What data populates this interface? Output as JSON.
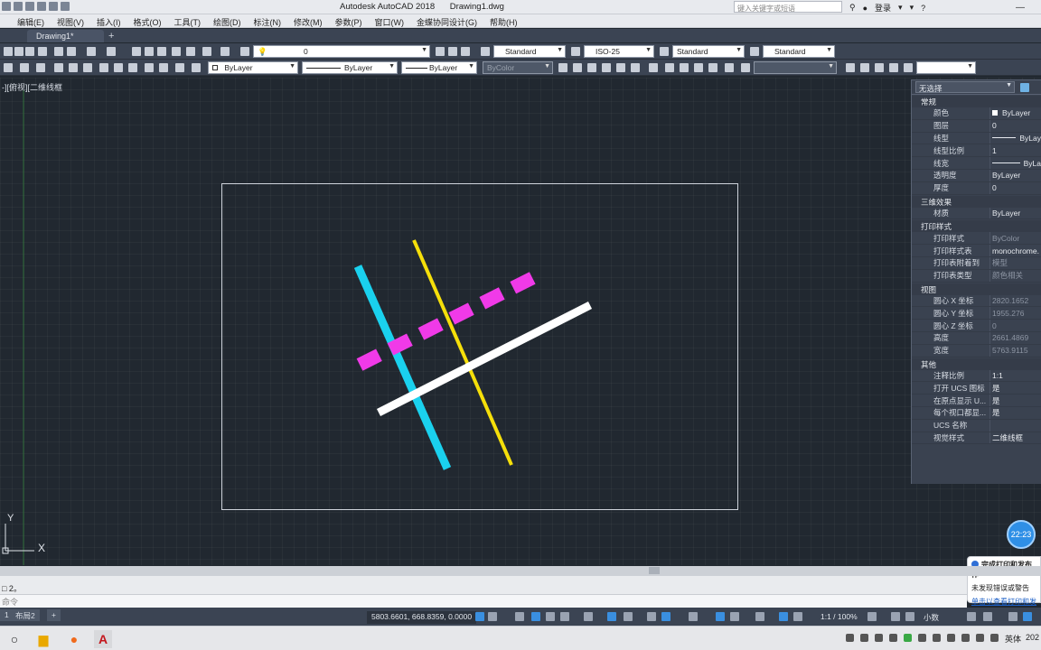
{
  "app": {
    "title": "Autodesk AutoCAD 2018",
    "document": "Drawing1.dwg",
    "search_placeholder": "键入关键字或短语",
    "signin": "登录"
  },
  "menu": [
    "编辑(E)",
    "视图(V)",
    "插入(I)",
    "格式(O)",
    "工具(T)",
    "绘图(D)",
    "标注(N)",
    "修改(M)",
    "参数(P)",
    "窗口(W)",
    "金蝶协同设计(G)",
    "帮助(H)"
  ],
  "file_tab": "Drawing1*",
  "toolbar": {
    "layer_value": "0",
    "text_style": "Standard",
    "dim_style": "ISO-25",
    "table_style": "Standard",
    "multileader_style": "Standard",
    "color": "ByLayer",
    "linetype": "ByLayer",
    "lineweight": "ByLayer",
    "plotstyle": "ByColor"
  },
  "viewport_label": "-][俯视][二维线框",
  "ucs": {
    "x": "X",
    "y": "Y"
  },
  "palette": {
    "selection": "无选择",
    "sections": [
      {
        "title": "常规",
        "rows": [
          {
            "k": "颜色",
            "v": "ByLayer",
            "kind": "swatch"
          },
          {
            "k": "图层",
            "v": "0"
          },
          {
            "k": "线型",
            "v": "ByLay",
            "kind": "line"
          },
          {
            "k": "线型比例",
            "v": "1"
          },
          {
            "k": "线宽",
            "v": "ByLa",
            "kind": "line"
          },
          {
            "k": "透明度",
            "v": "ByLayer"
          },
          {
            "k": "厚度",
            "v": "0"
          }
        ]
      },
      {
        "title": "三维效果",
        "rows": [
          {
            "k": "材质",
            "v": "ByLayer"
          }
        ]
      },
      {
        "title": "打印样式",
        "rows": [
          {
            "k": "打印样式",
            "v": "ByColor",
            "kind": "dim"
          },
          {
            "k": "打印样式表",
            "v": "monochrome."
          },
          {
            "k": "打印表附着到",
            "v": "模型",
            "kind": "dim"
          },
          {
            "k": "打印表类型",
            "v": "颜色相关",
            "kind": "dim"
          }
        ]
      },
      {
        "title": "视图",
        "rows": [
          {
            "k": "圆心 X 坐标",
            "v": "2820.1652",
            "kind": "dim"
          },
          {
            "k": "圆心 Y 坐标",
            "v": "1955.276",
            "kind": "dim"
          },
          {
            "k": "圆心 Z 坐标",
            "v": "0",
            "kind": "dim"
          },
          {
            "k": "高度",
            "v": "2661.4869",
            "kind": "dim"
          },
          {
            "k": "宽度",
            "v": "5763.9115",
            "kind": "dim"
          }
        ]
      },
      {
        "title": "其他",
        "rows": [
          {
            "k": "注释比例",
            "v": "1:1"
          },
          {
            "k": "打开 UCS 图标",
            "v": "是"
          },
          {
            "k": "在原点显示 U...",
            "v": "是"
          },
          {
            "k": "每个视口都显...",
            "v": "是"
          },
          {
            "k": "UCS 名称",
            "v": ""
          },
          {
            "k": "视觉样式",
            "v": "二维线框"
          }
        ]
      }
    ]
  },
  "clock_bubble": "22:23",
  "notification": {
    "title": "完成打印和发布作",
    "line": "未发现错误或警告",
    "link": "单击以查看打印和发"
  },
  "command": {
    "history": "□ 2。",
    "prompt": "命令"
  },
  "layout_tabs": [
    "1",
    "布局2"
  ],
  "status": {
    "coords": "5803.6601, 668.8359, 0.0000",
    "scale": "1:1 / 100%",
    "units": "小数"
  },
  "tray": {
    "lang": "英体",
    "year": "202"
  },
  "colors": {
    "cyan_line": "#1ad1ee",
    "yellow_line": "#f5df0a",
    "magenta_line": "#f03ae8",
    "white_line": "#ffffff"
  }
}
